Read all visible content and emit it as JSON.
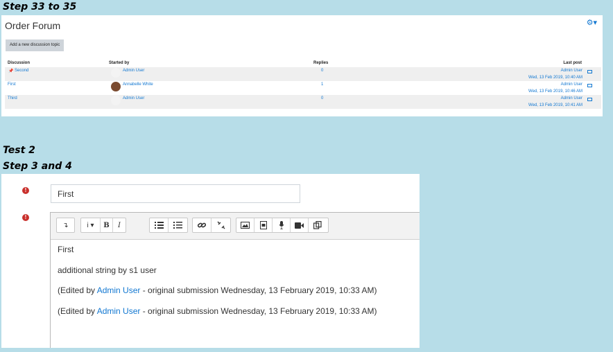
{
  "captions": {
    "step1": "Step 33 to 35",
    "test": "Test 2",
    "step2": "Step 3 and 4"
  },
  "forum": {
    "title": "Order Forum",
    "add_button": "Add a new discussion topic",
    "columns": {
      "discussion": "Discussion",
      "started_by": "Started by",
      "replies": "Replies",
      "last_post": "Last post"
    },
    "rows": [
      {
        "discussion": "Second",
        "pinned": true,
        "started_by": "Admin User",
        "avatar": "blank",
        "replies": "0",
        "last_user": "Admin User",
        "last_date": "Wed, 13 Feb 2019, 10:40 AM"
      },
      {
        "discussion": "First",
        "pinned": false,
        "started_by": "Annabelle White",
        "avatar": "photo",
        "replies": "1",
        "last_user": "Admin User",
        "last_date": "Wed, 13 Feb 2019, 10:46 AM"
      },
      {
        "discussion": "Third",
        "pinned": false,
        "started_by": "Admin User",
        "avatar": "blank",
        "replies": "0",
        "last_user": "Admin User",
        "last_date": "Wed, 13 Feb 2019, 10:41 AM"
      }
    ]
  },
  "editor": {
    "subject_value": "First",
    "content": {
      "line1": "First",
      "line2": "additional string by s1 user",
      "edit1_prefix": "(Edited by ",
      "edit1_user": "Admin User",
      "edit1_suffix": " - original submission Wednesday, 13 February 2019, 10:33 AM)",
      "edit2_prefix": "(Edited by ",
      "edit2_user": "Admin User",
      "edit2_suffix": " - original submission Wednesday, 13 February 2019, 10:33 AM)"
    },
    "toolbar": {
      "toggle": "↴",
      "info": "i ▾",
      "bold": "B",
      "italic": "I"
    }
  },
  "colors": {
    "background": "#b7dde8",
    "link": "#1177d1",
    "error": "#c9302c"
  }
}
